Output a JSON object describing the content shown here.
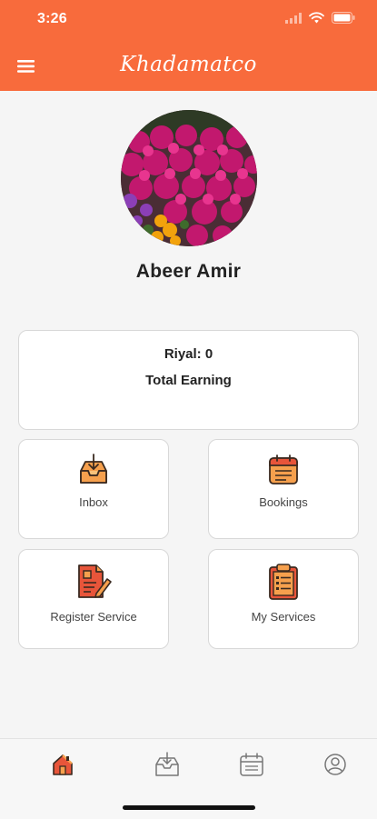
{
  "status_bar": {
    "time": "3:26"
  },
  "header": {
    "title": "Khadamatco",
    "menu_icon": "hamburger-menu-icon"
  },
  "profile": {
    "name": "Abeer Amir"
  },
  "earnings": {
    "riyal_line": "Riyal: 0",
    "label": "Total Earning"
  },
  "tiles": [
    {
      "label": "Inbox",
      "icon": "inbox-download-icon"
    },
    {
      "label": "Bookings",
      "icon": "calendar-icon"
    },
    {
      "label": "Register Service",
      "icon": "document-edit-icon"
    },
    {
      "label": "My Services",
      "icon": "clipboard-list-icon"
    }
  ],
  "tabbar": {
    "tabs": [
      {
        "icon": "home-icon",
        "active": true
      },
      {
        "icon": "inbox-icon",
        "active": false
      },
      {
        "icon": "calendar-icon",
        "active": false
      },
      {
        "icon": "user-icon",
        "active": false
      }
    ]
  },
  "colors": {
    "brand_orange": "#f86b3c",
    "icon_orange": "#f6a04d",
    "icon_red": "#e8553a",
    "tab_gray": "#777777"
  }
}
